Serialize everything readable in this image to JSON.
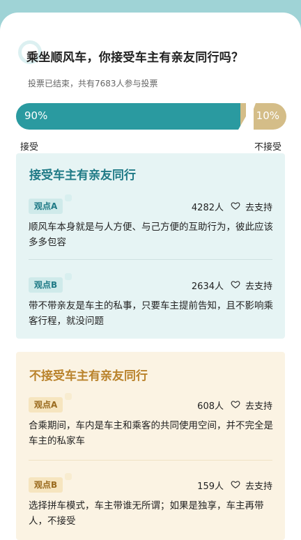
{
  "poll": {
    "question": "乘坐顺风车，你接受车主有亲友同行吗？",
    "status": "投票已结束，共有7683人参与投票",
    "accept_pct_label": "90%",
    "reject_pct_label": "10%",
    "accept_fraction": 0.9,
    "reject_fraction": 0.1,
    "accept_label": "接受",
    "reject_label": "不接受",
    "colors": {
      "accent": "#2a9aa0",
      "secondary": "#d4bd88"
    }
  },
  "accept_section": {
    "title": "接受车主有亲友同行",
    "opinions": [
      {
        "tag": "观点A",
        "count": "4282人",
        "action": "去支持",
        "text": "顺风车本身就是与人方便、与己方便的互助行为，彼此应该多多包容"
      },
      {
        "tag": "观点B",
        "count": "2634人",
        "action": "去支持",
        "text": "带不带亲友是车主的私事，只要车主提前告知，且不影响乘客行程，就没问题"
      }
    ]
  },
  "reject_section": {
    "title": "不接受车主有亲友同行",
    "opinions": [
      {
        "tag": "观点A",
        "count": "608人",
        "action": "去支持",
        "text": "合乘期间，车内是车主和乘客的共同使用空间，并不完全是车主的私家车"
      },
      {
        "tag": "观点B",
        "count": "159人",
        "action": "去支持",
        "text": "选择拼车模式，车主带谁无所谓；如果是独享，车主再带人，不接受"
      }
    ]
  },
  "icons": {
    "support": "heart-icon"
  }
}
